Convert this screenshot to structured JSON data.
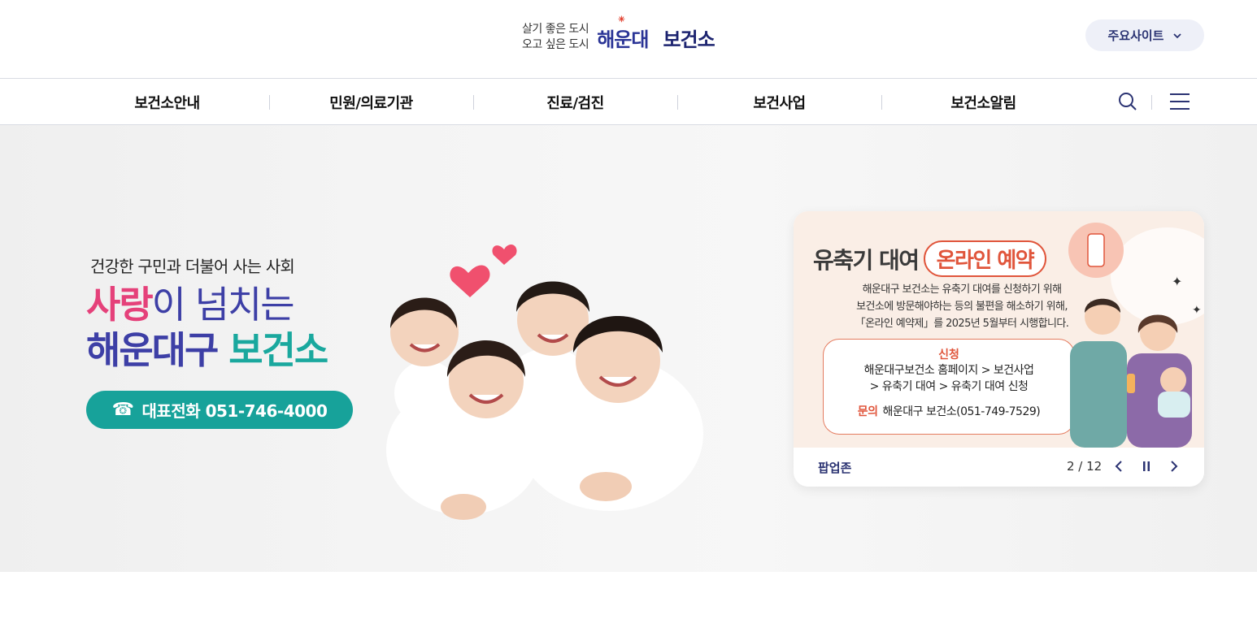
{
  "header": {
    "slogan_line1": "살기 좋은 도시",
    "slogan_line2": "오고 싶은 도시",
    "brand": "해운대",
    "org": "보건소",
    "sites_button": "주요사이트"
  },
  "nav": {
    "items": [
      "보건소안내",
      "민원/의료기관",
      "진료/검진",
      "보건사업",
      "보건소알림"
    ],
    "search_icon": "search-icon",
    "menu_icon": "hamburger-menu-icon"
  },
  "hero": {
    "subtitle": "건강한 구민과 더불어 사는 사회",
    "title_highlight": "사랑",
    "title_rest": "이 넘치는",
    "title2_part1": "해운대구",
    "title2_part2": "보건소",
    "phone_label": "대표전화 051-746-4000",
    "colors": {
      "pink": "#e5417a",
      "navy": "#3d3fa6",
      "teal": "#1aa89e"
    }
  },
  "popup": {
    "title": "유축기 대여",
    "title_tag": "온라인 예약",
    "desc_line1": "해운대구 보건소는 유축기 대여를 신청하기 위해",
    "desc_line2": "보건소에 방문해야하는 등의 불편을 해소하기 위해,",
    "desc_line3": "「온라인 예약제」를 2025년 5월부터 시행합니다.",
    "apply_label": "신청",
    "apply_path1": "해운대구보건소 홈페이지 > 보건사업",
    "apply_path2": "> 유축기 대여 > 유축기 대여 신청",
    "contact_label": "문의",
    "contact_value": "해운대구 보건소(051-749-7529)",
    "zone_label": "팝업존",
    "counter": "2 / 12"
  }
}
